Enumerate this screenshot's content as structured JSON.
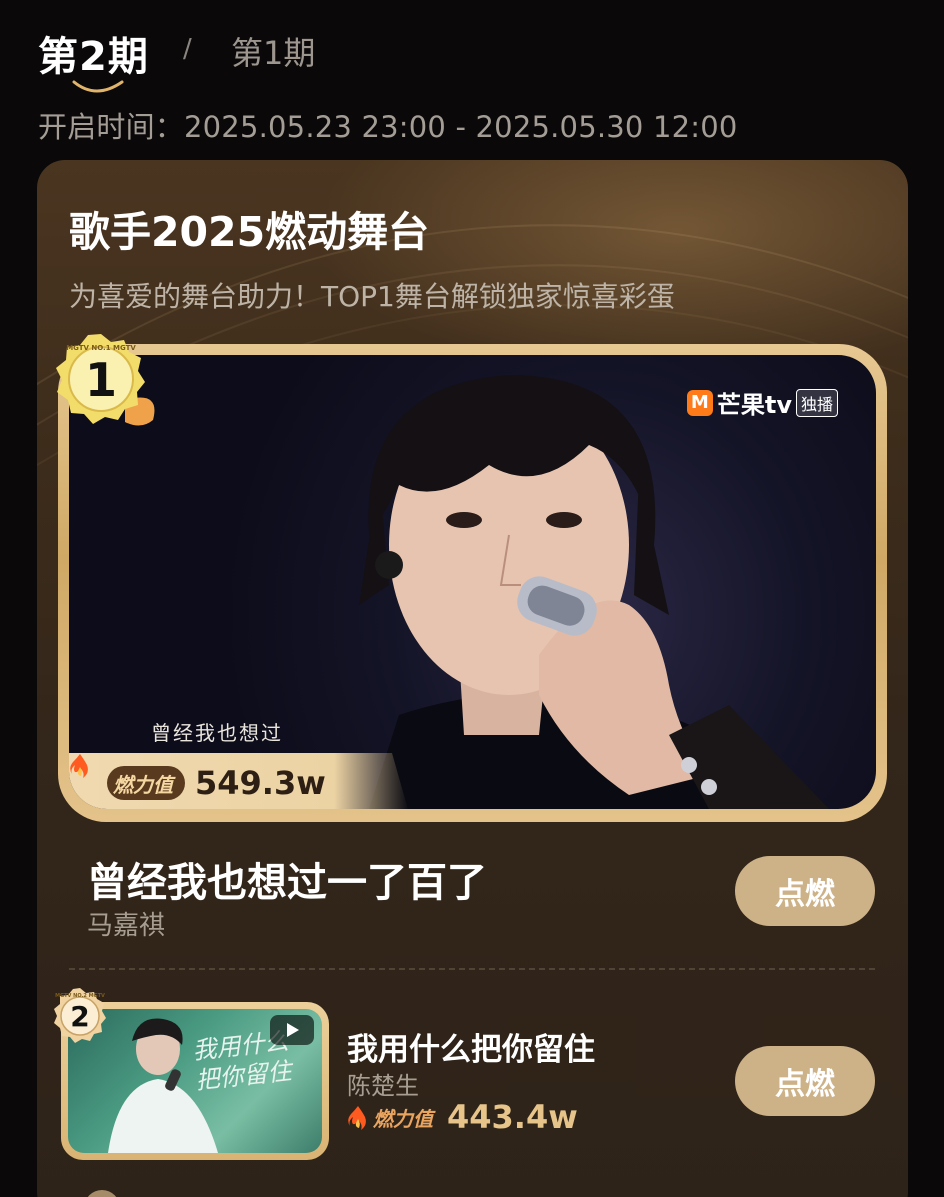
{
  "tabs": {
    "active": "第2期",
    "separator": "/",
    "inactive": "第1期"
  },
  "open_time": "开启时间：2025.05.23 23:00 - 2025.05.30 12:00",
  "card": {
    "title": "歌手2025燃动舞台",
    "subtitle": "为喜爱的舞台助力！TOP1舞台解锁独家惊喜彩蛋"
  },
  "top1": {
    "rank": "1",
    "medal_text": "MGTV NO.1 MGTV",
    "watermark": {
      "logo": "M",
      "brand": "芒果tv",
      "badge": "独播"
    },
    "lyric_caption": "曾经我也想过",
    "fire_label": "燃力值",
    "score": "549.3w",
    "song": "曾经我也想过一了百了",
    "singer": "马嘉祺",
    "ignite_label": "点燃"
  },
  "rank2": {
    "rank": "2",
    "medal_text": "MGTV NO.2 MGTV",
    "lyric": "我用什么\n把你留住",
    "song": "我用什么把你留住",
    "singer": "陈楚生",
    "fire_label": "燃力值",
    "score": "443.4w",
    "ignite_label": "点燃"
  },
  "colors": {
    "background": "#0a0808",
    "card": "#3d2c1b",
    "gold": "#cdb288",
    "score_gold": "#e6c48a"
  }
}
